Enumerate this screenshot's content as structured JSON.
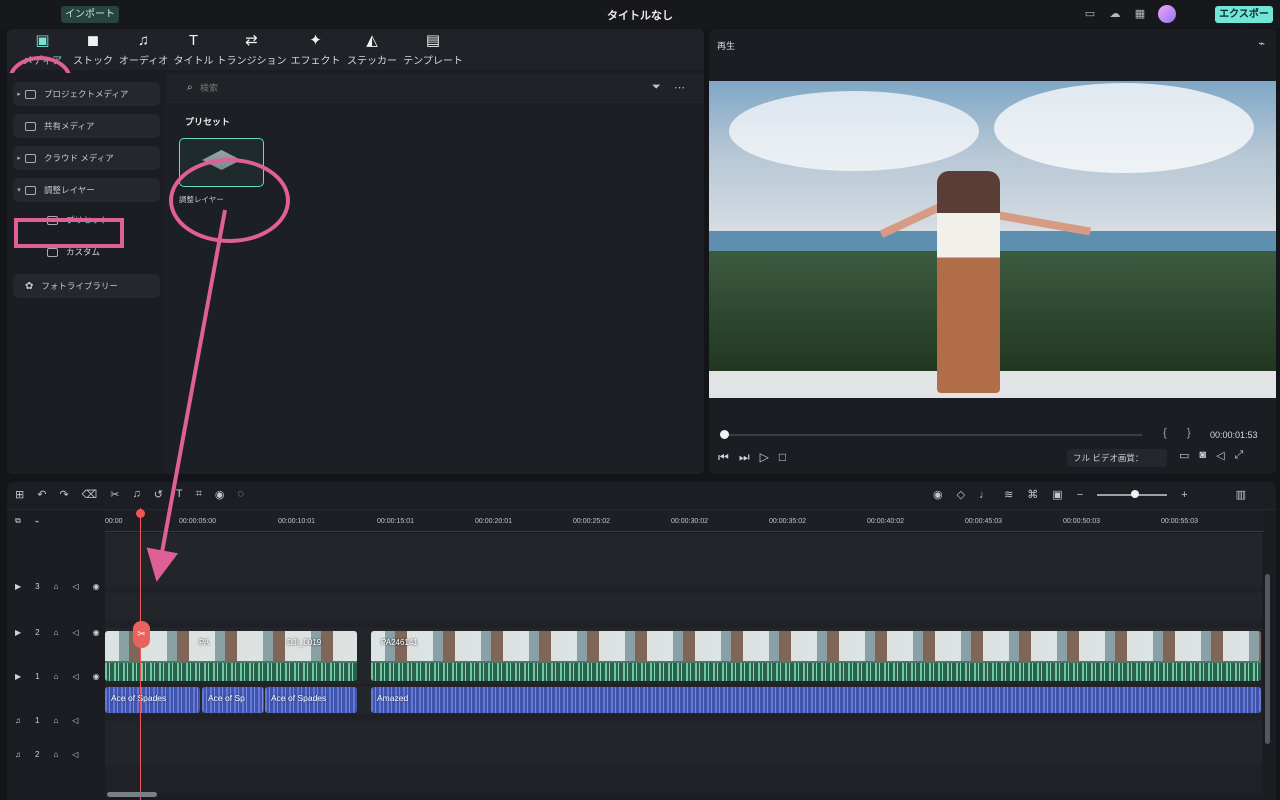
{
  "topbar": {
    "import_label": "インポート",
    "title": "タイトルなし",
    "export_label": "エクスポート"
  },
  "tabs": [
    {
      "label": "メディア",
      "icon": "image-icon"
    },
    {
      "label": "ストック",
      "icon": "stock-icon"
    },
    {
      "label": "オーディオ",
      "icon": "music-note-icon"
    },
    {
      "label": "タイトル",
      "icon": "text-icon"
    },
    {
      "label": "トランジション",
      "icon": "transition-icon"
    },
    {
      "label": "エフェクト",
      "icon": "effects-icon"
    },
    {
      "label": "ステッカー",
      "icon": "sticker-icon"
    },
    {
      "label": "テンプレート",
      "icon": "template-icon"
    }
  ],
  "sidebar": {
    "items": [
      {
        "label": "プロジェクトメディア"
      },
      {
        "label": "共有メディア"
      },
      {
        "label": "クラウド メディア"
      },
      {
        "label": "調整レイヤー"
      },
      {
        "label": "プリセット"
      },
      {
        "label": "カスタム"
      },
      {
        "label": "フォトライブラリー"
      }
    ]
  },
  "media": {
    "search_placeholder": "検索",
    "section_title": "プリセット",
    "cards": [
      {
        "label": "調整レイヤー"
      }
    ]
  },
  "preview": {
    "title": "再生",
    "timecode": "00:00:01:53",
    "quality_label": "フル ビデオ画質："
  },
  "timeline": {
    "ticks": [
      "00:00",
      "00:00:05:00",
      "00:00:10:01",
      "00:00:15:01",
      "00:00:20:01",
      "00:00:25:02",
      "00:00:30:02",
      "00:00:35:02",
      "00:00:40:02",
      "00:00:45:03",
      "00:00:50:03",
      "00:00:55:03"
    ],
    "tracks": [
      {
        "label": "3",
        "type": "video"
      },
      {
        "label": "2",
        "type": "video"
      },
      {
        "label": "1",
        "type": "video"
      },
      {
        "label": "1",
        "type": "audio"
      },
      {
        "label": "2",
        "type": "audio"
      }
    ],
    "video_clips": [
      {
        "label": "PA"
      },
      {
        "label": "DJI_0019"
      },
      {
        "label": "PA246141"
      }
    ],
    "audio_clips": [
      {
        "label": "Ace of Spades"
      },
      {
        "label": "Ace of Sp"
      },
      {
        "label": "Ace of Spades"
      },
      {
        "label": "Amazed"
      }
    ]
  },
  "colors": {
    "accent": "#70e6d7",
    "annotation_pink": "#df5f97",
    "playhead": "#ef5757"
  }
}
